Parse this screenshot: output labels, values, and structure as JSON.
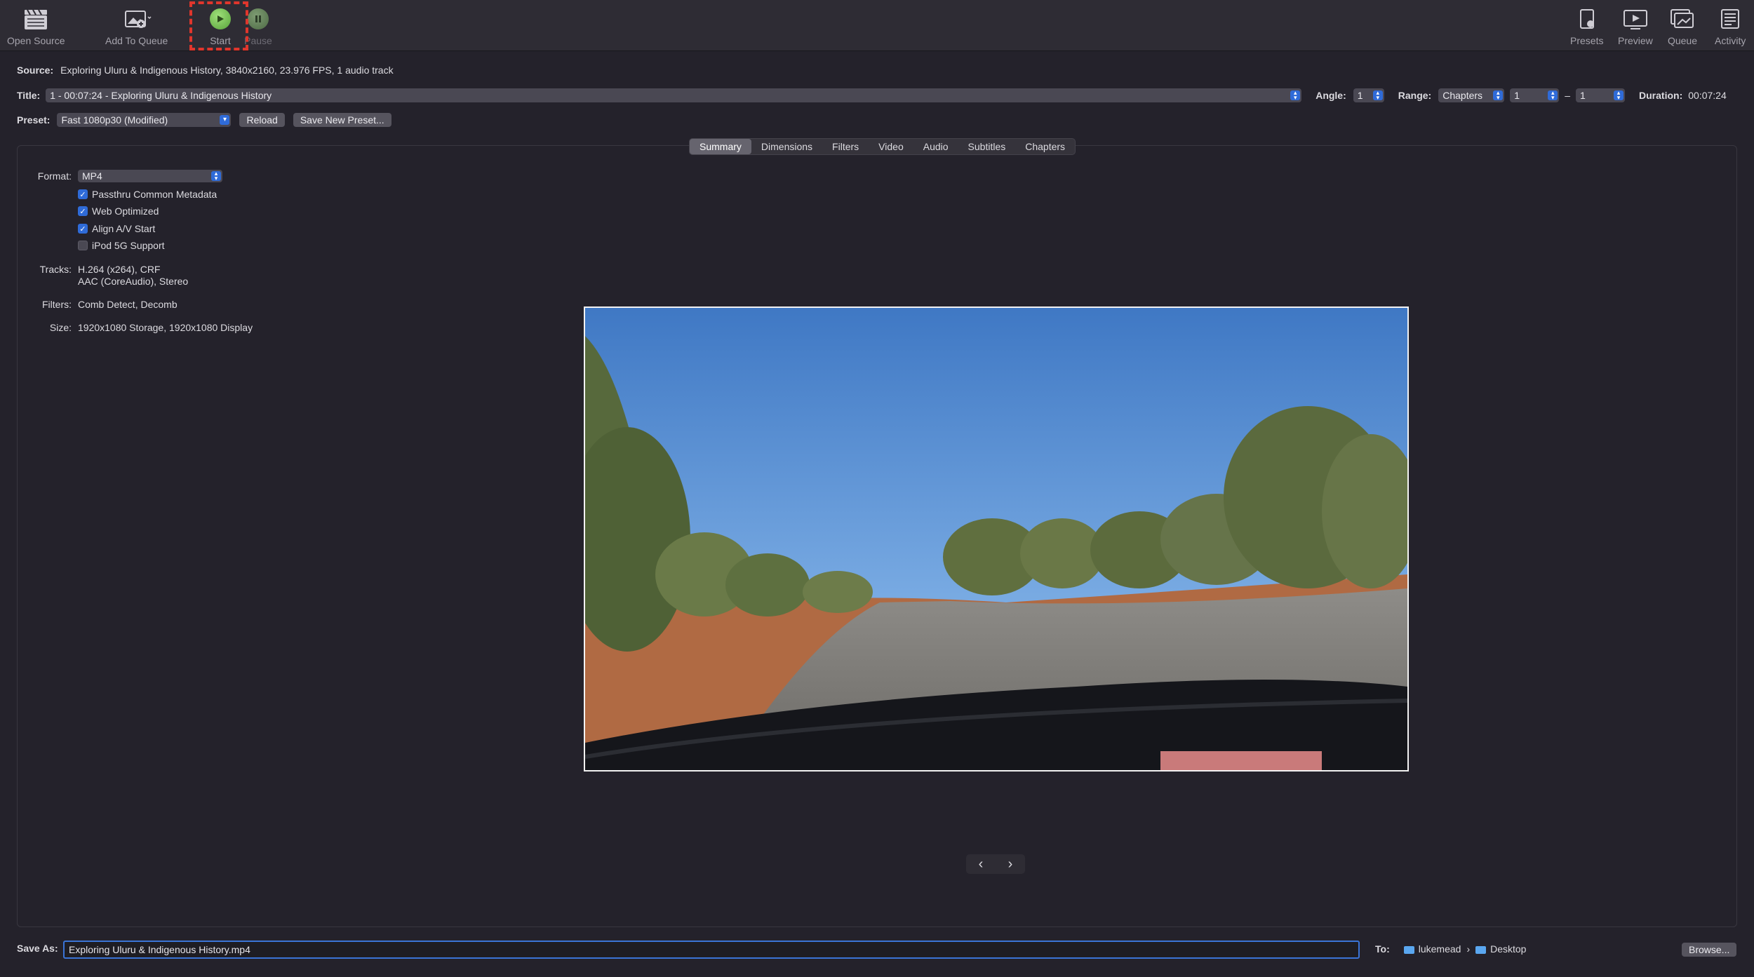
{
  "toolbar": {
    "open_source": "Open Source",
    "add_to_queue": "Add To Queue",
    "start": "Start",
    "pause": "Pause",
    "presets": "Presets",
    "preview": "Preview",
    "queue": "Queue",
    "activity": "Activity"
  },
  "source": {
    "label": "Source:",
    "value": "Exploring Uluru & Indigenous History, 3840x2160, 23.976 FPS, 1 audio track"
  },
  "title_row": {
    "label": "Title:",
    "value": "1 - 00:07:24 - Exploring Uluru & Indigenous History",
    "angle_label": "Angle:",
    "angle_value": "1",
    "range_label": "Range:",
    "range_value": "Chapters",
    "range_start": "1",
    "range_sep": "–",
    "range_end": "1",
    "duration_label": "Duration:",
    "duration_value": "00:07:24"
  },
  "preset_row": {
    "label": "Preset:",
    "value": "Fast 1080p30 (Modified)",
    "reload": "Reload",
    "save_new": "Save New Preset..."
  },
  "tabs": [
    "Summary",
    "Dimensions",
    "Filters",
    "Video",
    "Audio",
    "Subtitles",
    "Chapters"
  ],
  "summary": {
    "format_label": "Format:",
    "format_value": "MP4",
    "checkboxes": [
      {
        "label": "Passthru Common Metadata",
        "checked": true
      },
      {
        "label": "Web Optimized",
        "checked": true
      },
      {
        "label": "Align A/V Start",
        "checked": true
      },
      {
        "label": "iPod 5G Support",
        "checked": false
      }
    ],
    "tracks_label": "Tracks:",
    "tracks_line1": "H.264 (x264), CRF",
    "tracks_line2": "AAC (CoreAudio), Stereo",
    "filters_label": "Filters:",
    "filters_value": "Comb Detect, Decomb",
    "size_label": "Size:",
    "size_value": "1920x1080 Storage, 1920x1080 Display"
  },
  "nav": {
    "prev": "‹",
    "next": "›"
  },
  "save": {
    "label": "Save As:",
    "value": "Exploring Uluru & Indigenous History.mp4",
    "to_label": "To:",
    "path_user": "lukemead",
    "path_sep": "›",
    "path_folder": "Desktop",
    "browse": "Browse..."
  }
}
